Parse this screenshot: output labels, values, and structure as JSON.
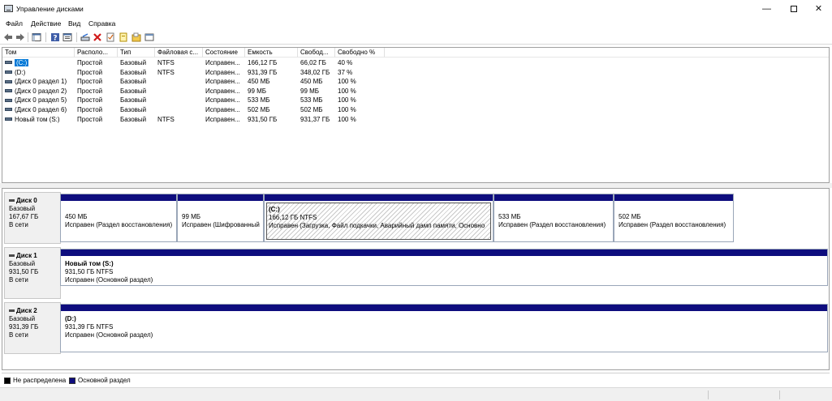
{
  "window": {
    "title": "Управление дисками"
  },
  "menu": [
    "Файл",
    "Действие",
    "Вид",
    "Справка"
  ],
  "toolbar_icons": [
    "back-arrow-icon",
    "forward-arrow-icon",
    "console-tree-icon",
    "help-icon",
    "properties-icon",
    "connect-icon",
    "delete-icon",
    "check-icon",
    "new-volume-icon",
    "open-icon",
    "refresh-icon"
  ],
  "volume_list": {
    "columns": [
      "Том",
      "Располо...",
      "Тип",
      "Файловая с...",
      "Состояние",
      "Емкость",
      "Свобод...",
      "Свободно %"
    ],
    "rows": [
      [
        "(C:)",
        "Простой",
        "Базовый",
        "NTFS",
        "Исправен...",
        "166,12 ГБ",
        "66,02 ГБ",
        "40 %"
      ],
      [
        "(D:)",
        "Простой",
        "Базовый",
        "NTFS",
        "Исправен...",
        "931,39 ГБ",
        "348,02 ГБ",
        "37 %"
      ],
      [
        "(Диск 0 раздел 1)",
        "Простой",
        "Базовый",
        "",
        "Исправен...",
        "450 МБ",
        "450 МБ",
        "100 %"
      ],
      [
        "(Диск 0 раздел 2)",
        "Простой",
        "Базовый",
        "",
        "Исправен...",
        "99 МБ",
        "99 МБ",
        "100 %"
      ],
      [
        "(Диск 0 раздел 5)",
        "Простой",
        "Базовый",
        "",
        "Исправен...",
        "533 МБ",
        "533 МБ",
        "100 %"
      ],
      [
        "(Диск 0 раздел 6)",
        "Простой",
        "Базовый",
        "",
        "Исправен...",
        "502 МБ",
        "502 МБ",
        "100 %"
      ],
      [
        "Новый том (S:)",
        "Простой",
        "Базовый",
        "NTFS",
        "Исправен...",
        "931,50 ГБ",
        "931,37 ГБ",
        "100 %"
      ]
    ]
  },
  "disks": [
    {
      "name": "Диск 0",
      "type": "Базовый",
      "size": "167,67 ГБ",
      "state": "В сети",
      "partitions": [
        {
          "title": "",
          "line1": "450 МБ",
          "line2": "Исправен (Раздел восстановления)"
        },
        {
          "title": "",
          "line1": "99 МБ",
          "line2": "Исправен (Шифрованный"
        },
        {
          "title": "(C:)",
          "line1": "166,12 ГБ NTFS",
          "line2": "Исправен (Загрузка, Файл подкачки, Аварийный дамп памяти, Основно"
        },
        {
          "title": "",
          "line1": "533 МБ",
          "line2": "Исправен (Раздел восстановления)"
        },
        {
          "title": "",
          "line1": "502 МБ",
          "line2": "Исправен (Раздел восстановления)"
        }
      ]
    },
    {
      "name": "Диск 1",
      "type": "Базовый",
      "size": "931,50 ГБ",
      "state": "В сети",
      "partitions": [
        {
          "title": "Новый том (S:)",
          "line1": "931,50 ГБ NTFS",
          "line2": "Исправен (Основной раздел)"
        }
      ]
    },
    {
      "name": "Диск 2",
      "type": "Базовый",
      "size": "931,39 ГБ",
      "state": "В сети",
      "partitions": [
        {
          "title": "(D:)",
          "line1": "931,39 ГБ NTFS",
          "line2": "Исправен (Основной раздел)"
        }
      ]
    }
  ],
  "legend": [
    {
      "label": "Не распределена",
      "color": "#000000"
    },
    {
      "label": "Основной раздел",
      "color": "#0e0d7e"
    }
  ]
}
